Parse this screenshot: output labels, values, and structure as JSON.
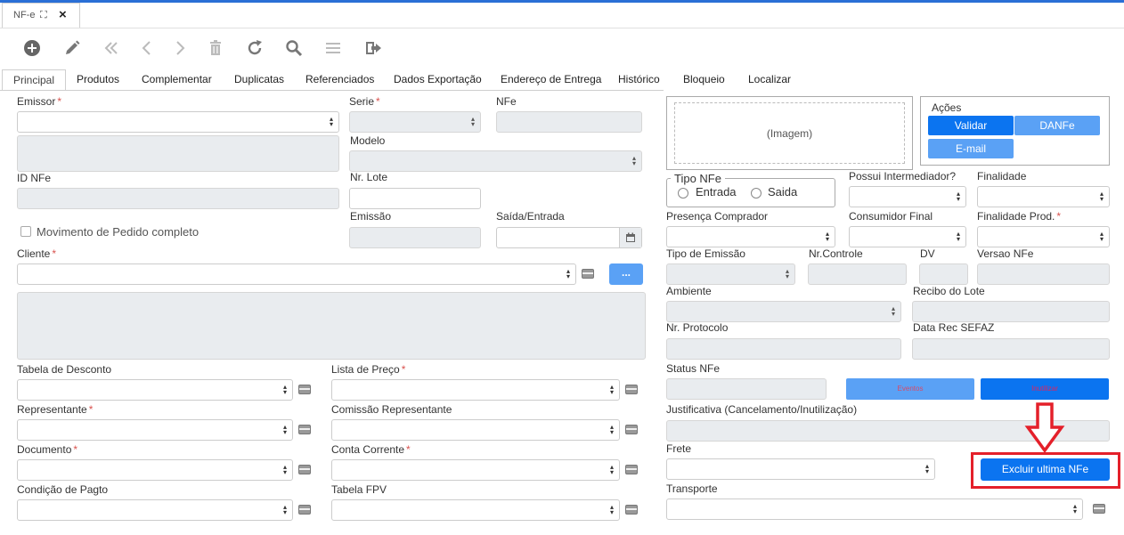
{
  "window_tab": {
    "title": "NF-e",
    "maximize": "⛶",
    "close": "×"
  },
  "form_tabs": [
    "Principal",
    "Produtos",
    "Complementar",
    "Duplicatas",
    "Referenciados",
    "Dados Exportação",
    "Endereço de Entrega",
    "Histórico",
    "Bloqueio",
    "Localizar"
  ],
  "labels": {
    "emissor": "Emissor",
    "serie": "Serie",
    "nfe": "NFe",
    "modelo": "Modelo",
    "id_nfe": "ID NFe",
    "nr_lote": "Nr. Lote",
    "emissao": "Emissão",
    "saida_entrada": "Saída/Entrada",
    "movimento": "Movimento de Pedido completo",
    "cliente": "Cliente",
    "tabela_desconto": "Tabela de Desconto",
    "lista_preco": "Lista de Preço",
    "representante": "Representante",
    "comissao": "Comissão Representante",
    "documento": "Documento",
    "conta_corrente": "Conta Corrente",
    "condicao_pagto": "Condição de Pagto",
    "tabela_fpv": "Tabela FPV",
    "tipo_nfe": "Tipo NFe",
    "entrada": "Entrada",
    "saida": "Saida",
    "possui_intermediador": "Possui Intermediador?",
    "finalidade": "Finalidade",
    "presenca": "Presença Comprador",
    "consumidor_final": "Consumidor Final",
    "finalidade_prod": "Finalidade Prod.",
    "tipo_emissao": "Tipo de Emissão",
    "nr_controle": "Nr.Controle",
    "dv": "DV",
    "versao_nfe": "Versao NFe",
    "ambiente": "Ambiente",
    "recibo_lote": "Recibo do Lote",
    "nr_protocolo": "Nr. Protocolo",
    "data_rec_sefaz": "Data Rec SEFAZ",
    "status_nfe": "Status NFe",
    "justificativa": "Justificativa (Cancelamento/Inutilização)",
    "frete": "Frete",
    "transporte": "Transporte"
  },
  "required_mark": "*",
  "image_placeholder": "(Imagem)",
  "acoes": {
    "title": "Ações",
    "validar": "Validar",
    "danfe": "DANFe",
    "email": "E-mail"
  },
  "buttons": {
    "dots": "...",
    "eventos": "Eventos",
    "inutilizar": "Inutilizar",
    "excluir": "Excluir ultima NFe"
  },
  "colors": {
    "accent": "#0b74f0",
    "light_accent": "#5aa1f5",
    "highlight": "#e4202a"
  }
}
